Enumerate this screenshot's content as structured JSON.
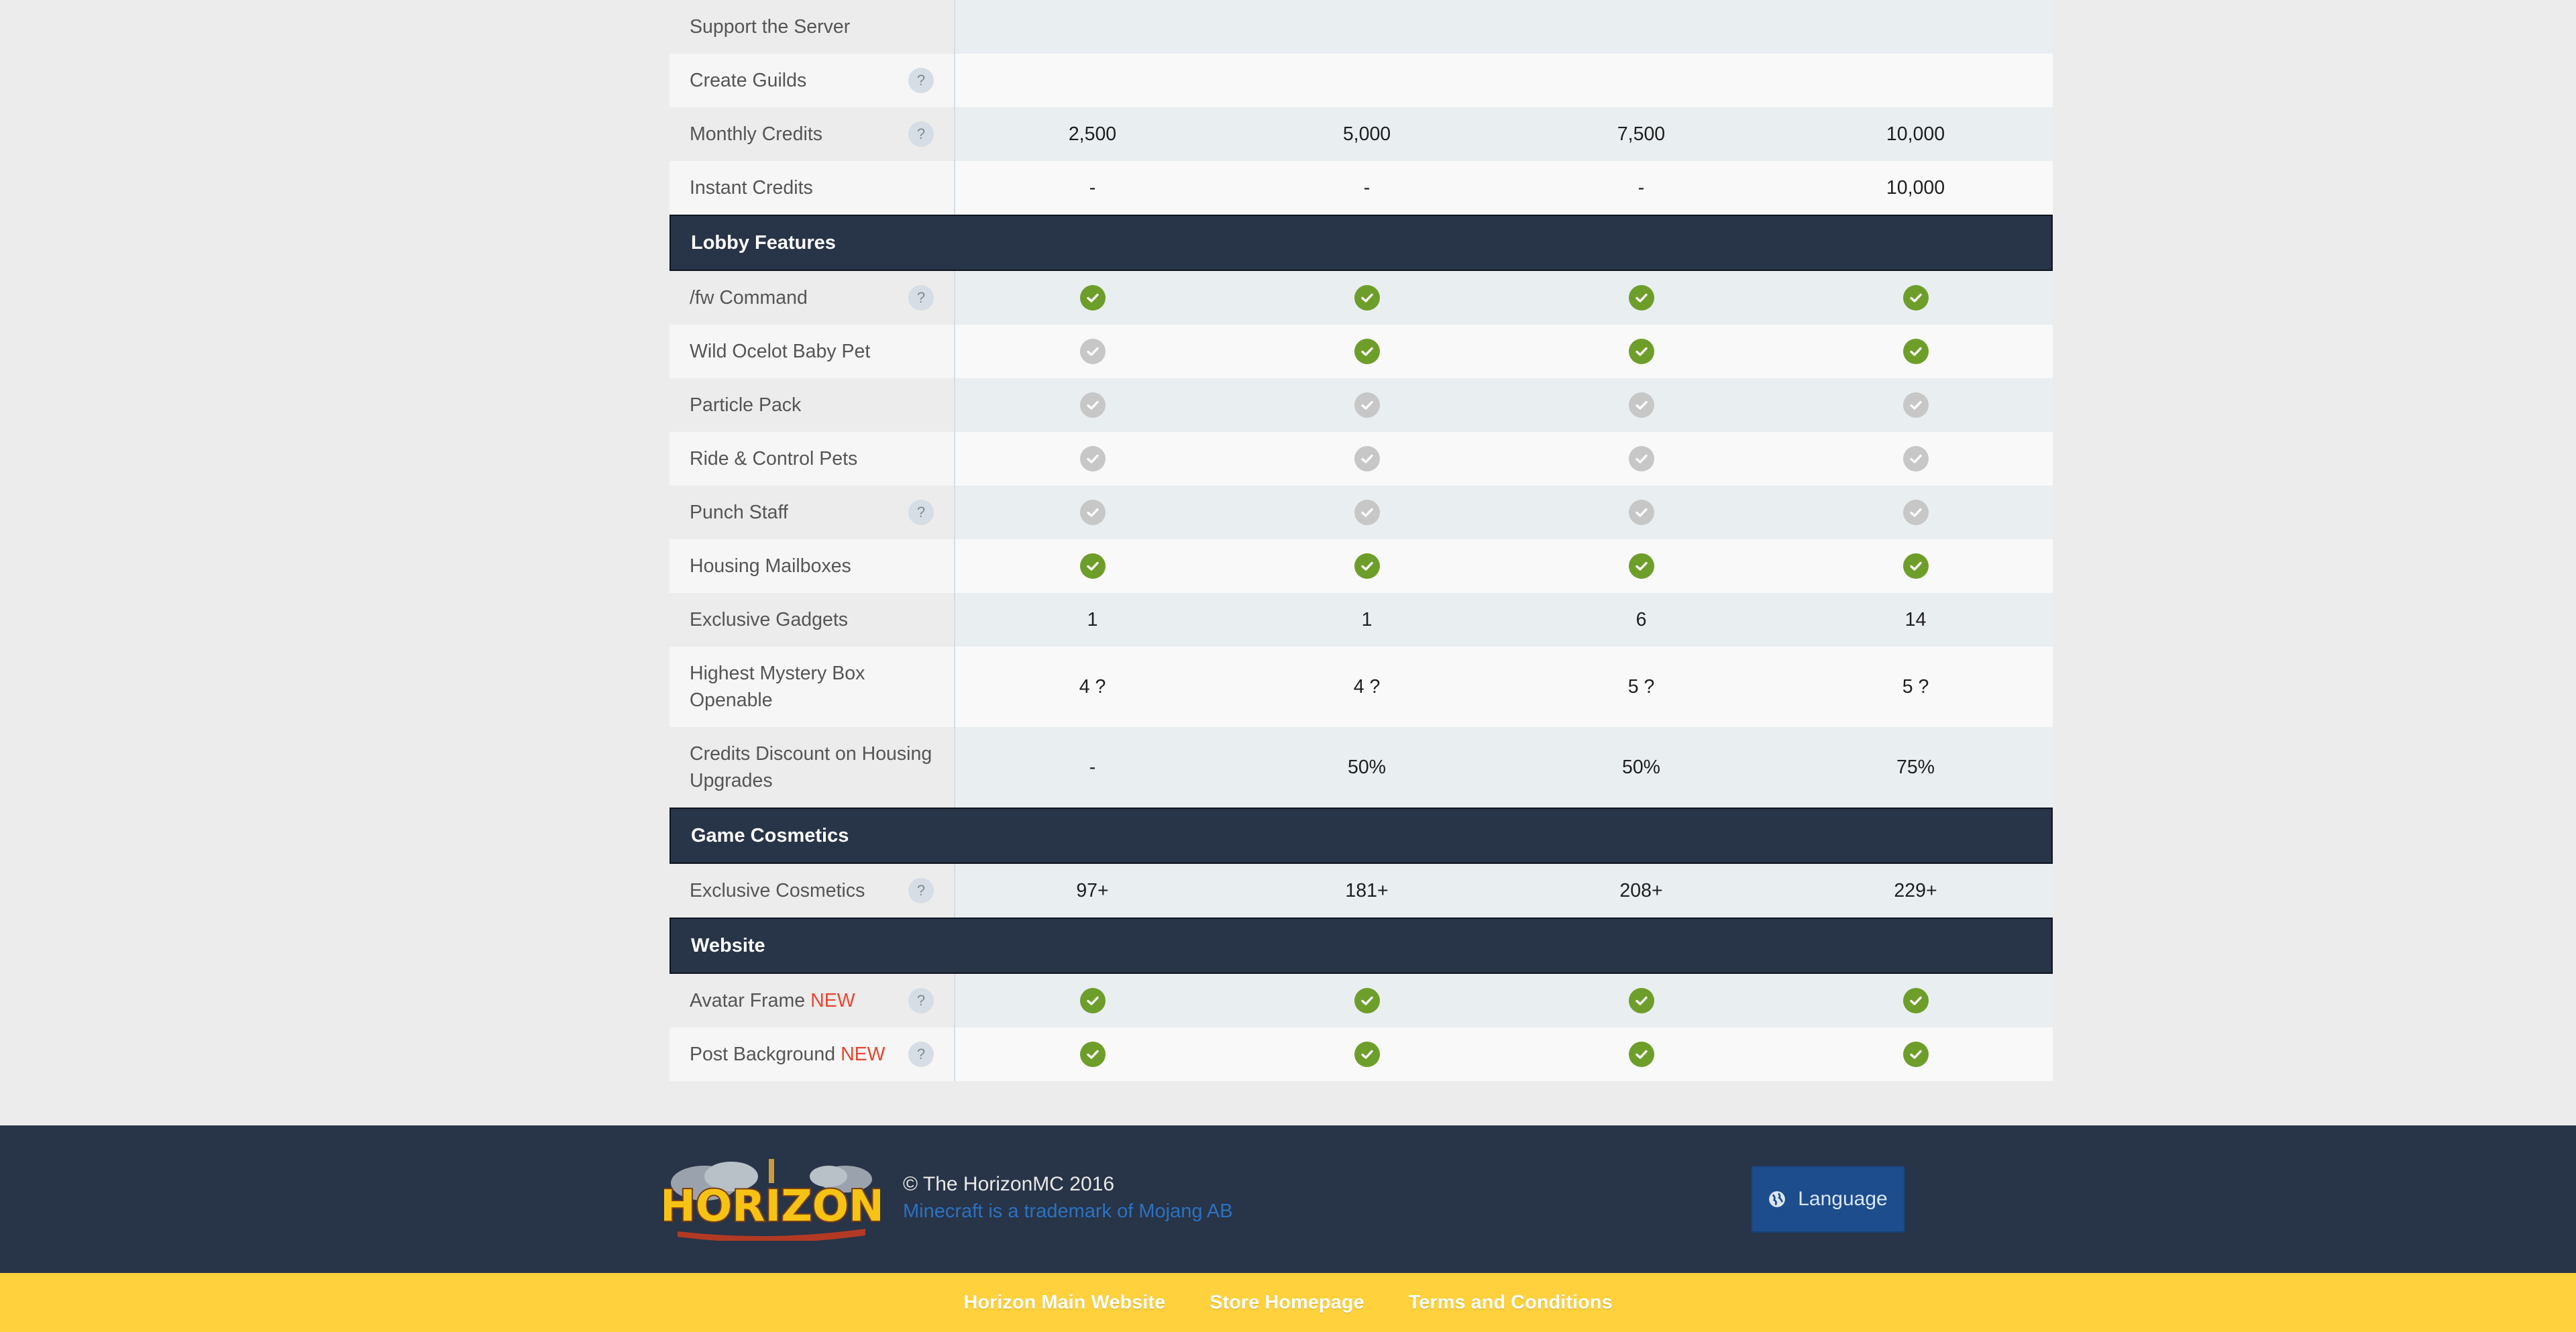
{
  "rows": [
    {
      "type": "row",
      "label": "Support the Server",
      "help": false,
      "cells": [
        "",
        "",
        "",
        ""
      ]
    },
    {
      "type": "row",
      "label": "Create Guilds",
      "help": true,
      "cells": [
        "",
        "",
        "",
        ""
      ]
    },
    {
      "type": "row",
      "label": "Monthly Credits",
      "help": true,
      "cells": [
        "2,500",
        "5,000",
        "7,500",
        "10,000"
      ]
    },
    {
      "type": "row",
      "label": "Instant Credits",
      "help": false,
      "cells": [
        "-",
        "-",
        "-",
        "10,000"
      ]
    },
    {
      "type": "section",
      "label": "Lobby Features"
    },
    {
      "type": "row",
      "label": "/fw Command",
      "help": true,
      "cells": [
        "check-on",
        "check-on",
        "check-on",
        "check-on"
      ]
    },
    {
      "type": "row",
      "label": "Wild Ocelot Baby Pet",
      "help": false,
      "cells": [
        "check-off",
        "check-on",
        "check-on",
        "check-on"
      ]
    },
    {
      "type": "row",
      "label": "Particle Pack",
      "help": false,
      "cells": [
        "check-off",
        "check-off",
        "check-off",
        "check-off"
      ]
    },
    {
      "type": "row",
      "label": "Ride & Control Pets",
      "help": false,
      "cells": [
        "check-off",
        "check-off",
        "check-off",
        "check-off"
      ]
    },
    {
      "type": "row",
      "label": "Punch Staff",
      "help": true,
      "cells": [
        "check-off",
        "check-off",
        "check-off",
        "check-off"
      ]
    },
    {
      "type": "row",
      "label": "Housing Mailboxes",
      "help": false,
      "cells": [
        "check-on",
        "check-on",
        "check-on",
        "check-on"
      ]
    },
    {
      "type": "row",
      "label": "Exclusive Gadgets",
      "help": false,
      "cells": [
        "1",
        "1",
        "6",
        "14"
      ]
    },
    {
      "type": "row",
      "label": "Highest Mystery Box Openable",
      "help": false,
      "tall": true,
      "cells": [
        "4 ?",
        "4 ?",
        "5 ?",
        "5 ?"
      ]
    },
    {
      "type": "row",
      "label": "Credits Discount on Housing Upgrades",
      "help": false,
      "tall": true,
      "cells": [
        "-",
        "50%",
        "50%",
        "75%"
      ]
    },
    {
      "type": "section",
      "label": "Game Cosmetics"
    },
    {
      "type": "row",
      "label": "Exclusive Cosmetics",
      "help": true,
      "cells": [
        "97+",
        "181+",
        "208+",
        "229+"
      ]
    },
    {
      "type": "section",
      "label": "Website"
    },
    {
      "type": "row",
      "label": "Avatar Frame",
      "new": "NEW",
      "help": true,
      "cells": [
        "check-on",
        "check-on",
        "check-on",
        "check-on"
      ]
    },
    {
      "type": "row",
      "label": "Post Background",
      "new": "NEW",
      "help": true,
      "cells": [
        "check-on",
        "check-on",
        "check-on",
        "check-on"
      ]
    }
  ],
  "help_glyph": "?",
  "footer": {
    "logo_text": "HORIZON",
    "copyright": "© The HorizonMC 2016",
    "mojang": "Minecraft is a trademark of Mojang AB",
    "language_button": "Language"
  },
  "bottom_links": [
    "Horizon Main Website",
    "Store Homepage",
    "Terms and Conditions"
  ],
  "colors": {
    "section_bg": "#283447",
    "check_on": "#6e9e2a",
    "check_off": "#c7c7c7",
    "new_badge": "#e8452f",
    "footer_bg": "#283447",
    "bottom_bar": "#fed13d",
    "language_button": "#1d4d8c"
  }
}
